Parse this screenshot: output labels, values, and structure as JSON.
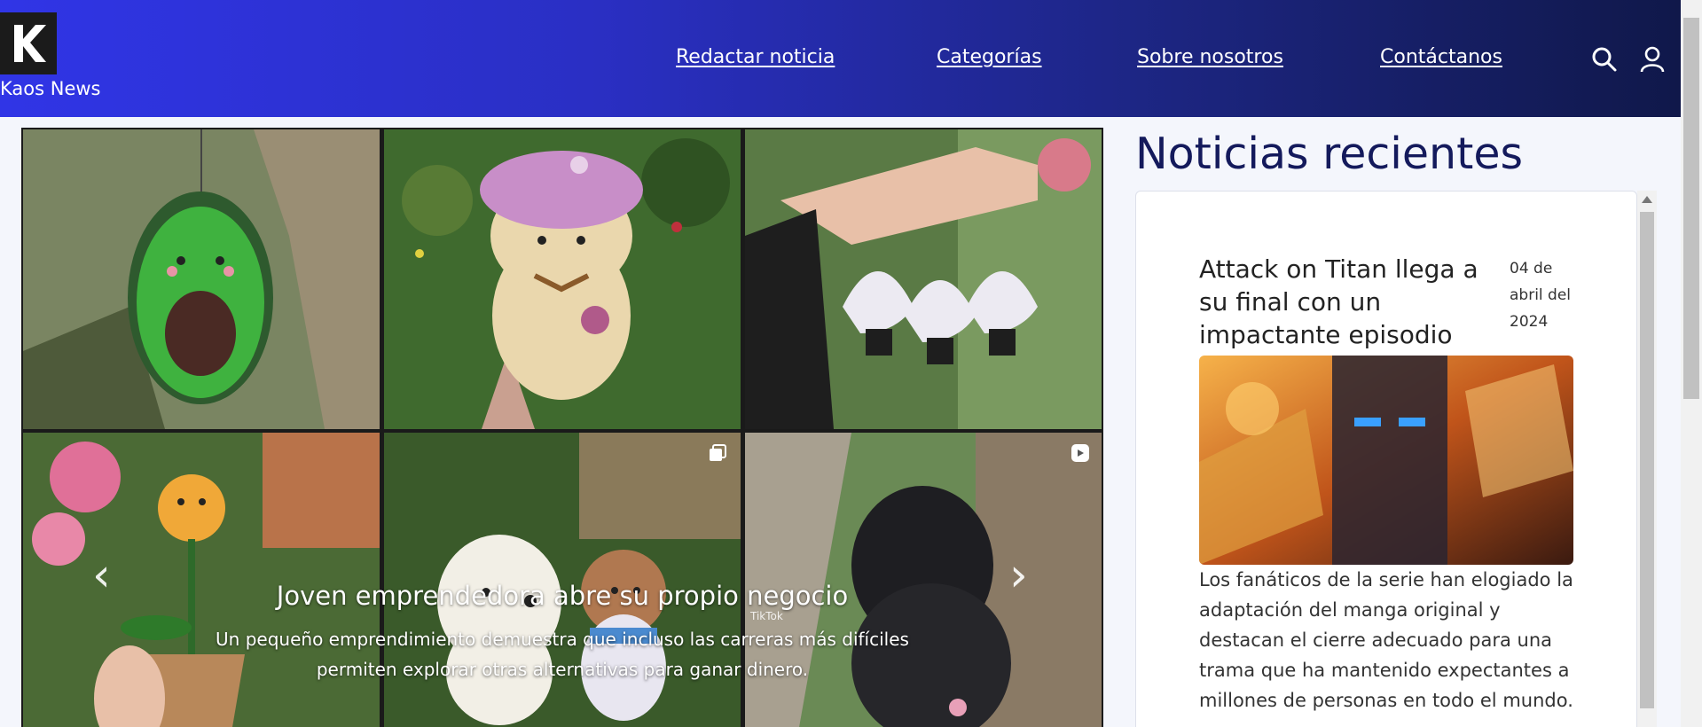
{
  "header": {
    "brand": "Kaos News",
    "logo_letter": "K",
    "nav": [
      "Redactar noticia",
      "Categorías",
      "Sobre nosotros",
      "Contáctanos"
    ],
    "icons": [
      "search-icon",
      "user-icon"
    ]
  },
  "carousel": {
    "title": "Joven emprendedora abre su propio negocio",
    "description": "Un pequeño emprendimiento demuestra que incluso las carreras más difíciles permiten explorar otras alternativas para ganar dinero.",
    "prev_arrow": "‹",
    "next_arrow": "›",
    "watermark": "TikTok"
  },
  "sidebar": {
    "title": "Noticias recientes",
    "news": [
      {
        "title": "Attack on Titan llega a su final con un impactante episodio",
        "date": "04 de abril del 2024",
        "text": "Los fanáticos de la serie han elogiado la adaptación del manga original y destacan el cierre adecuado para una trama que ha mantenido expectantes a millones de personas en todo el mundo."
      }
    ]
  },
  "colors": {
    "header_start": "#3035e6",
    "header_end": "#10184a",
    "sidebar_title": "#141a5c"
  }
}
